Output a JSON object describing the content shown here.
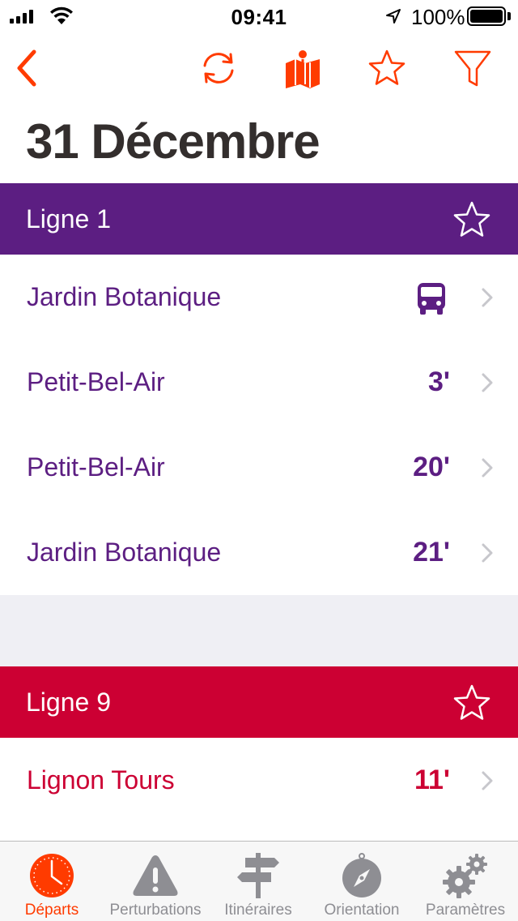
{
  "status_bar": {
    "time": "09:41",
    "battery": "100%"
  },
  "nav": {
    "icons": [
      "chevron-left-icon",
      "refresh-icon",
      "map-icon",
      "star-icon",
      "filter-icon"
    ],
    "accent_color": "#ff3b00"
  },
  "page": {
    "title": "31 Décembre"
  },
  "lines": [
    {
      "name": "Ligne 1",
      "color": "#5c1e82",
      "departures": [
        {
          "destination": "Jardin Botanique",
          "time": "",
          "icon": "bus-icon"
        },
        {
          "destination": "Petit-Bel-Air",
          "time": "3'"
        },
        {
          "destination": "Petit-Bel-Air",
          "time": "20'"
        },
        {
          "destination": "Jardin Botanique",
          "time": "21'"
        }
      ]
    },
    {
      "name": "Ligne 9",
      "color": "#cc0033",
      "departures": [
        {
          "destination": "Lignon Tours",
          "time": "11'"
        }
      ]
    }
  ],
  "tabbar": {
    "tabs": [
      {
        "label": "Départs",
        "icon": "clock-icon",
        "active": true
      },
      {
        "label": "Perturbations",
        "icon": "warning-icon",
        "active": false
      },
      {
        "label": "Itinéraires",
        "icon": "signpost-icon",
        "active": false
      },
      {
        "label": "Orientation",
        "icon": "compass-icon",
        "active": false
      },
      {
        "label": "Paramètres",
        "icon": "gears-icon",
        "active": false
      }
    ],
    "active_color": "#ff3b00",
    "inactive_color": "#8e8e93"
  }
}
